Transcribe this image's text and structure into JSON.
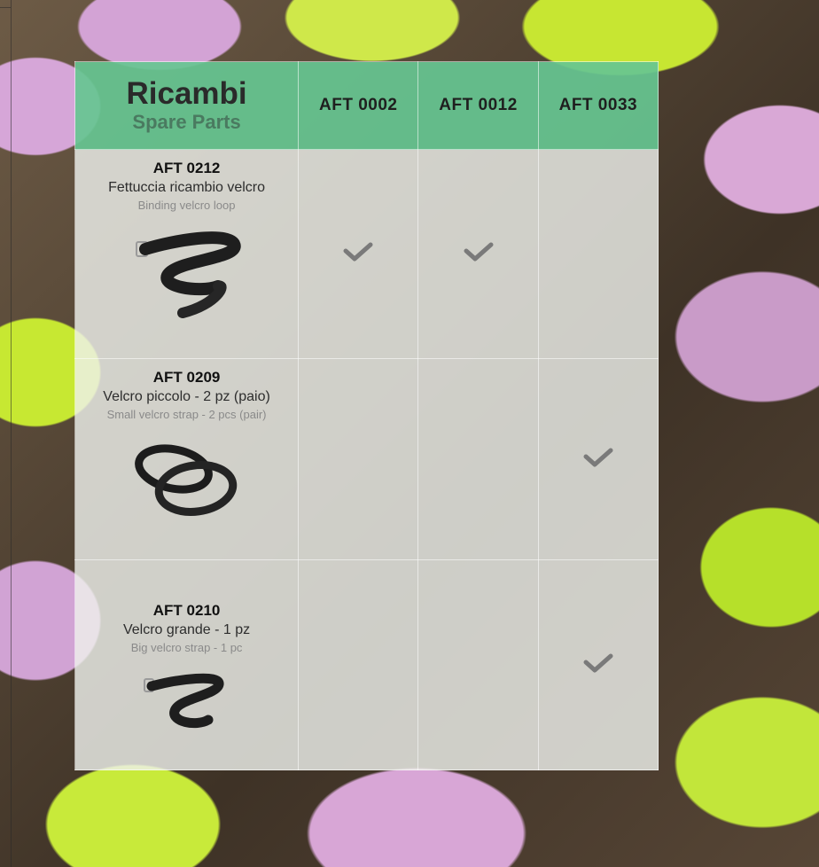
{
  "header": {
    "title": "Ricambi",
    "subtitle": "Spare Parts",
    "columns": [
      "AFT 0002",
      "AFT 0012",
      "AFT 0033"
    ]
  },
  "rows": [
    {
      "code": "AFT 0212",
      "name_it": "Fettuccia ricambio velcro",
      "name_en": "Binding velcro loop",
      "compatible": [
        true,
        true,
        false
      ]
    },
    {
      "code": "AFT 0209",
      "name_it": "Velcro piccolo - 2 pz (paio)",
      "name_en": "Small velcro strap - 2 pcs (pair)",
      "compatible": [
        false,
        false,
        true
      ]
    },
    {
      "code": "AFT 0210",
      "name_it": "Velcro grande - 1 pz",
      "name_en": "Big velcro strap - 1 pc",
      "compatible": [
        false,
        false,
        true
      ]
    }
  ],
  "colors": {
    "header_green": "#66c691",
    "check_gray": "#7a7a7a",
    "subtitle_green": "#4a7a60"
  },
  "icons": [
    "checkmark-icon",
    "velcro-strap-image"
  ]
}
